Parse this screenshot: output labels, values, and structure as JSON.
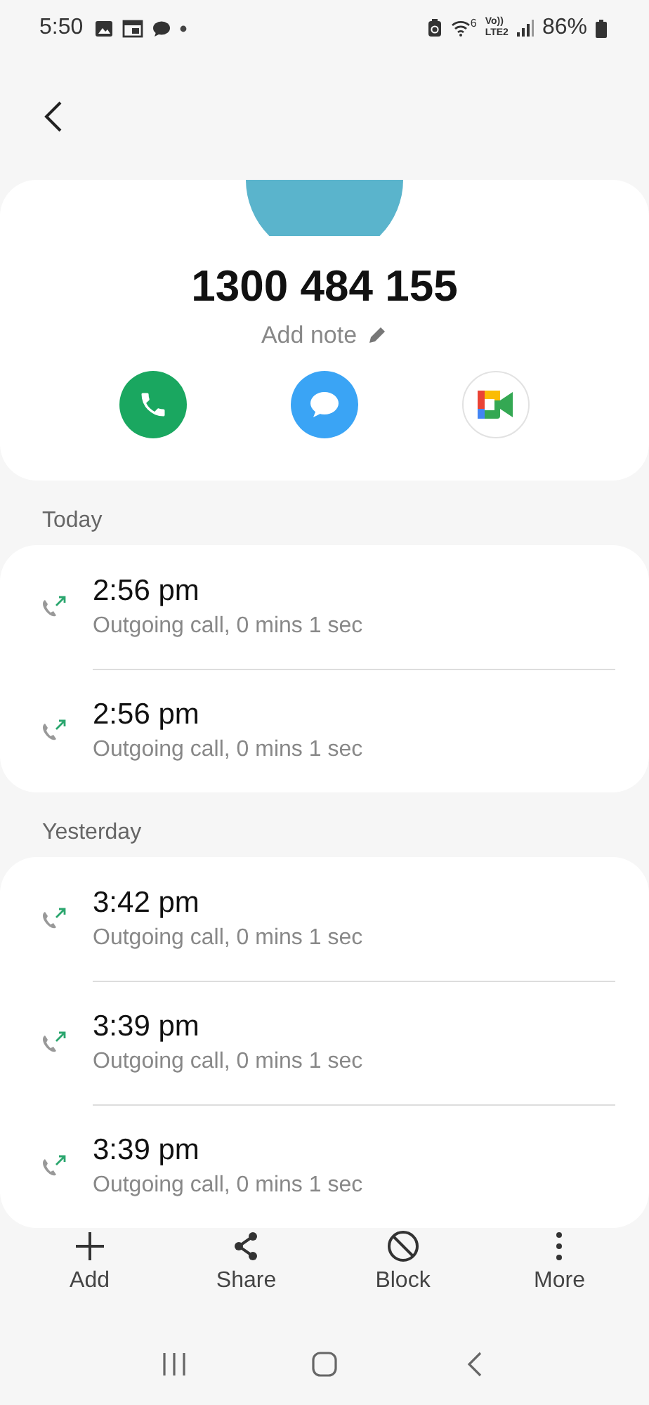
{
  "status_bar": {
    "time": "5:50",
    "wifi_band": "6",
    "voice_label": "Vo))",
    "network_label": "LTE2",
    "battery": "86%"
  },
  "contact": {
    "number": "1300 484 155",
    "note_placeholder": "Add note"
  },
  "sections": [
    {
      "title": "Today",
      "calls": [
        {
          "kind": "outgoing",
          "time": "2:56 pm",
          "detail": "Outgoing call, 0 mins 1 sec"
        },
        {
          "kind": "outgoing",
          "time": "2:56 pm",
          "detail": "Outgoing call, 0 mins 1 sec"
        }
      ]
    },
    {
      "title": "Yesterday",
      "calls": [
        {
          "kind": "outgoing",
          "time": "3:42 pm",
          "detail": "Outgoing call, 0 mins 1 sec"
        },
        {
          "kind": "outgoing",
          "time": "3:39 pm",
          "detail": "Outgoing call, 0 mins 1 sec"
        },
        {
          "kind": "outgoing",
          "time": "3:39 pm",
          "detail": "Outgoing call, 0 mins 1 sec"
        }
      ]
    }
  ],
  "toolbar": [
    {
      "kind": "add",
      "label": "Add"
    },
    {
      "kind": "share",
      "label": "Share"
    },
    {
      "kind": "block",
      "label": "Block"
    },
    {
      "kind": "more",
      "label": "More"
    }
  ]
}
